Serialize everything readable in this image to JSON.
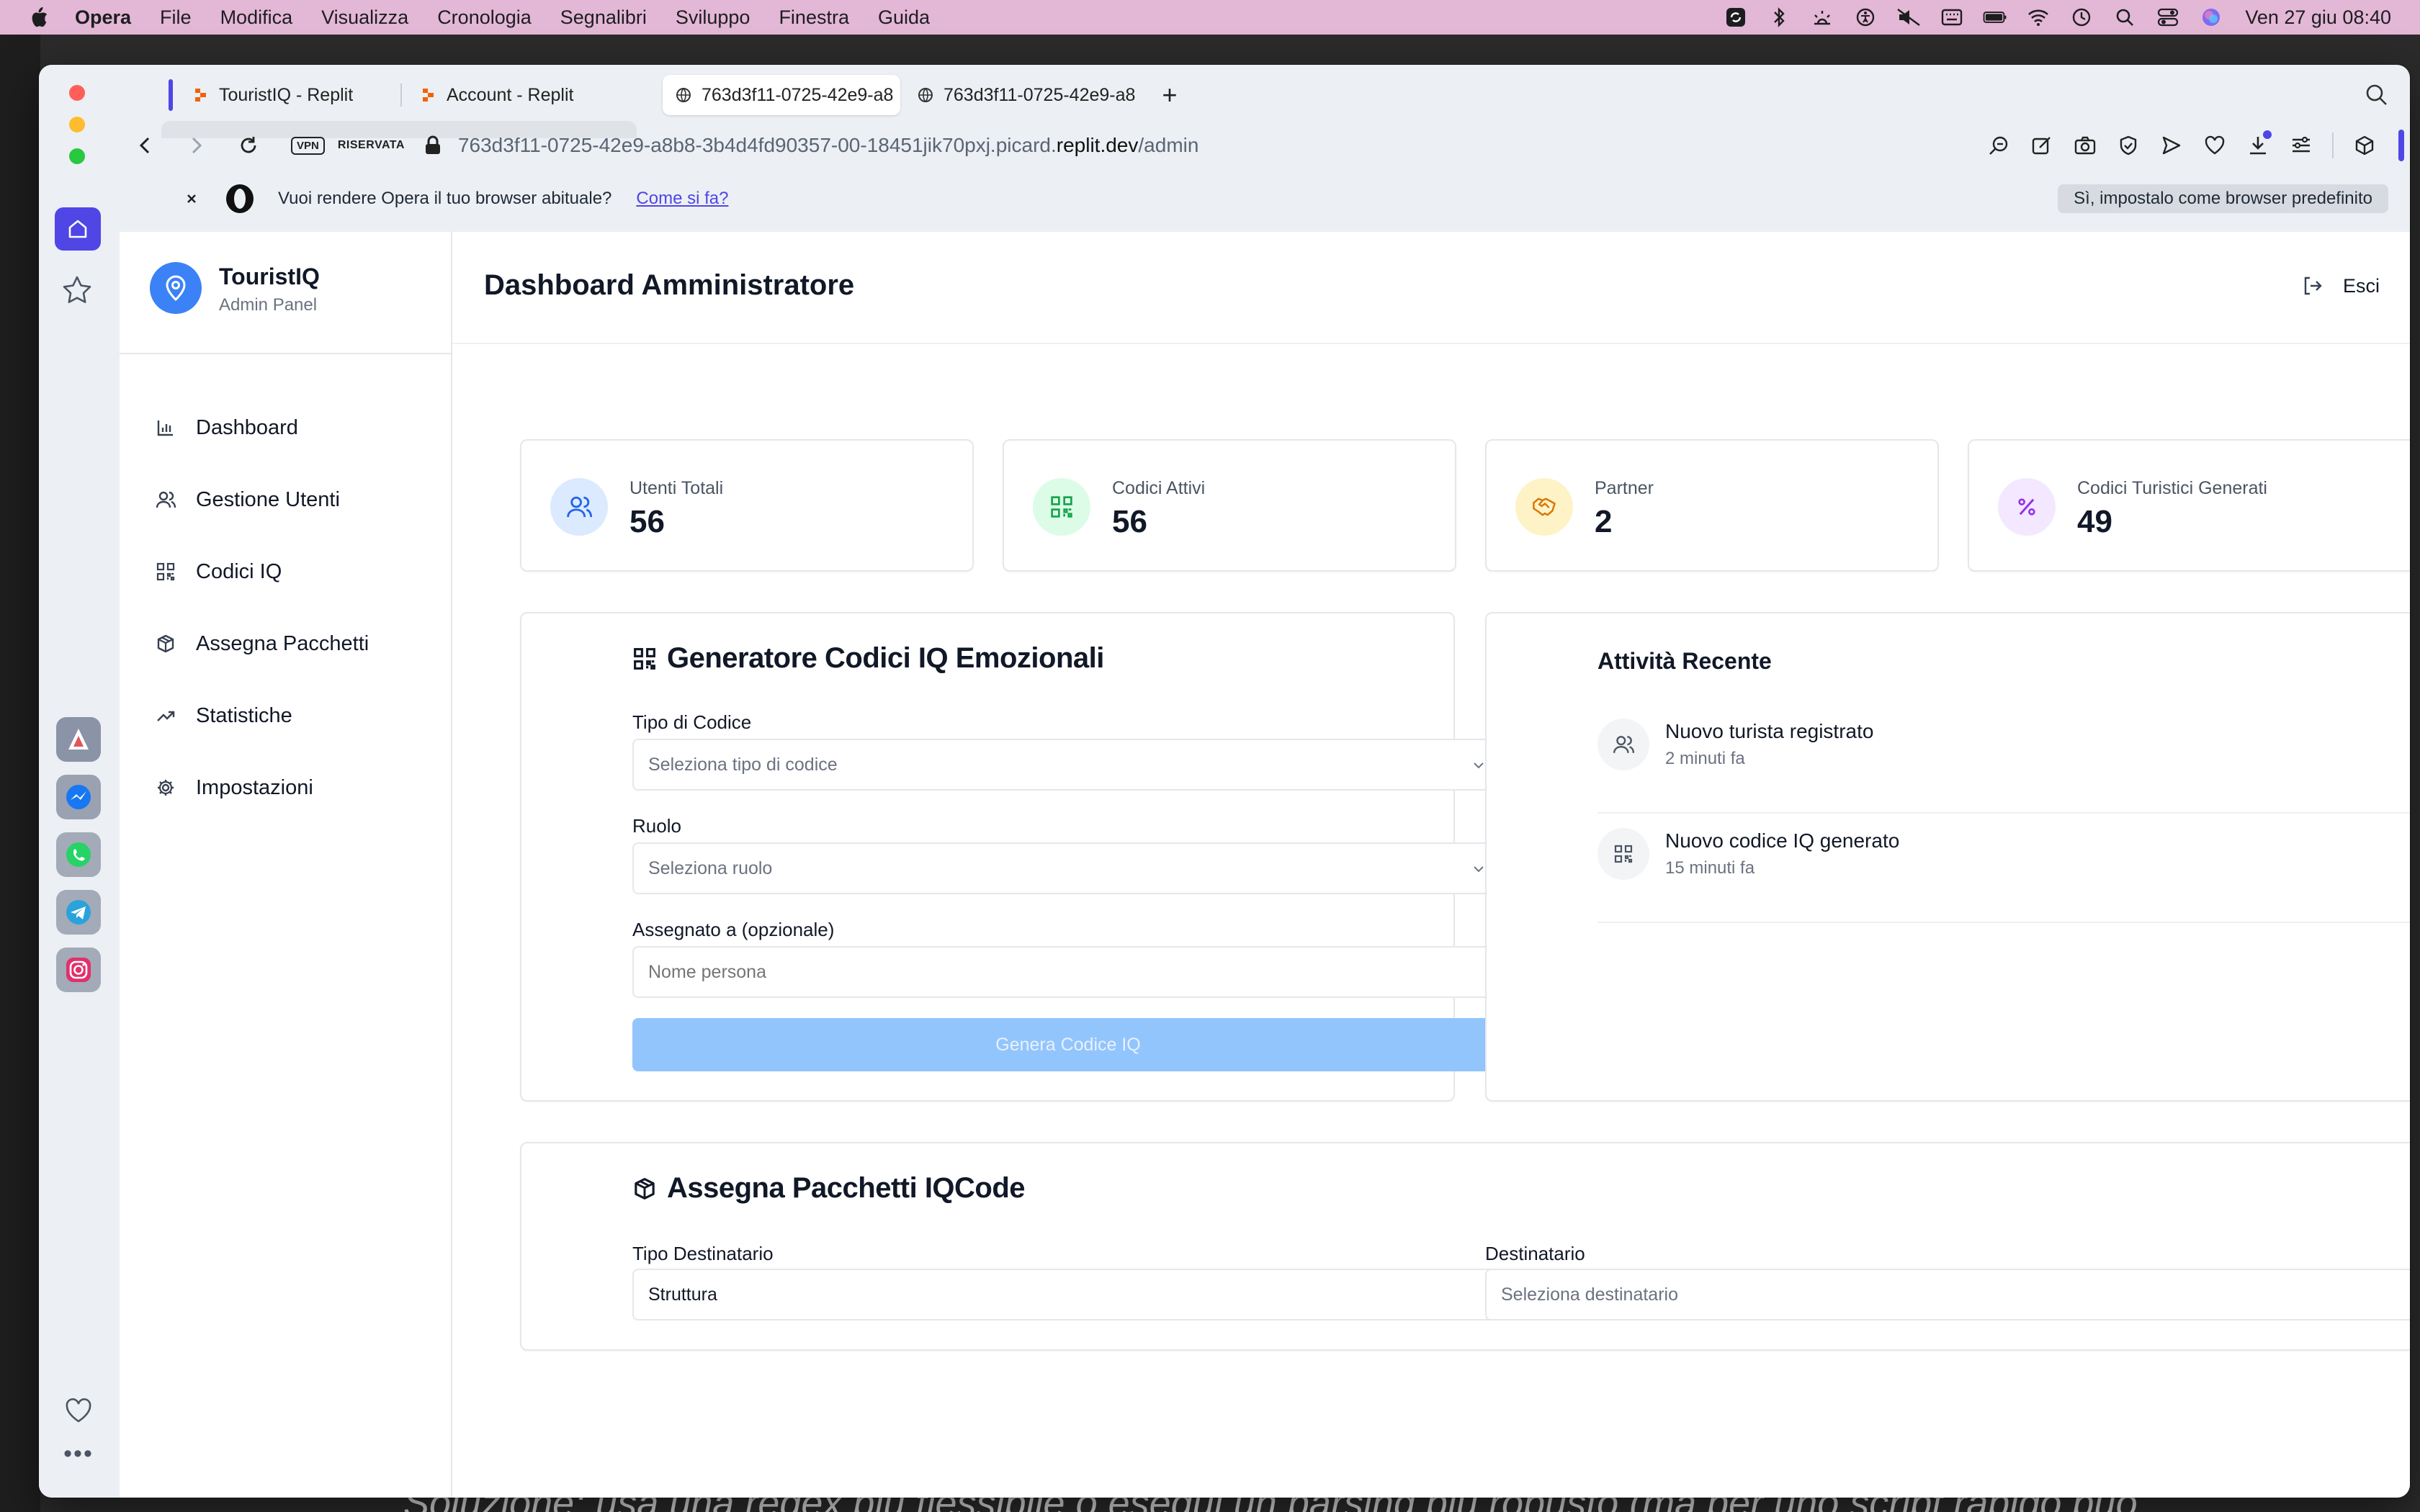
{
  "menubar": {
    "app": "Opera",
    "items": [
      "File",
      "Modifica",
      "Visualizza",
      "Cronologia",
      "Segnalibri",
      "Sviluppo",
      "Finestra",
      "Guida"
    ],
    "datetime": "Ven 27 giu  08:40"
  },
  "background": {
    "bottom_text": "Soluzione: usa una regex più flessibile o esegui un parsing più robusto (ma per uno script rapido può"
  },
  "tabs": [
    {
      "title": "TouristIQ - Replit",
      "icon": "replit-icon"
    },
    {
      "title": "Account - Replit",
      "icon": "replit-icon"
    },
    {
      "title": "763d3f11-0725-42e9-a8",
      "icon": "globe-icon",
      "active": true
    },
    {
      "title": "763d3f11-0725-42e9-a8",
      "icon": "globe-icon"
    }
  ],
  "addressbar": {
    "vpn": "VPN",
    "private": "RISERVATA",
    "url_prefix": "763d3f11-0725-42e9-a8b8-3b4d4fd90357-00-18451jik70pxj.picard.",
    "url_host": "replit.dev",
    "url_path": "/admin"
  },
  "notice": {
    "text": "Vuoi rendere Opera il tuo browser abituale?",
    "link": "Come si fa?",
    "button": "Sì, impostalo come browser predefinito"
  },
  "app": {
    "brand_name": "TouristIQ",
    "brand_sub": "Admin Panel",
    "nav": [
      {
        "label": "Dashboard",
        "icon": "bar-chart-icon"
      },
      {
        "label": "Gestione Utenti",
        "icon": "users-icon"
      },
      {
        "label": "Codici IQ",
        "icon": "qr-code-icon"
      },
      {
        "label": "Assegna Pacchetti",
        "icon": "package-icon"
      },
      {
        "label": "Statistiche",
        "icon": "trending-up-icon"
      },
      {
        "label": "Impostazioni",
        "icon": "settings-icon"
      }
    ],
    "page_title": "Dashboard Amministratore",
    "logout": "Esci"
  },
  "stats": [
    {
      "label": "Utenti Totali",
      "value": "56",
      "icon": "users-icon",
      "bg": "#dbeafe",
      "fg": "#2563eb"
    },
    {
      "label": "Codici Attivi",
      "value": "56",
      "icon": "qr-code-icon",
      "bg": "#dcfce7",
      "fg": "#16a34a"
    },
    {
      "label": "Partner",
      "value": "2",
      "icon": "handshake-icon",
      "bg": "#fef3c7",
      "fg": "#d97706"
    },
    {
      "label": "Codici Turistici Generati",
      "value": "49",
      "icon": "percent-icon",
      "bg": "#f3e8ff",
      "fg": "#9333ea"
    }
  ],
  "generator": {
    "title": "Generatore Codici IQ Emozionali",
    "type_label": "Tipo di Codice",
    "type_placeholder": "Seleziona tipo di codice",
    "role_label": "Ruolo",
    "role_placeholder": "Seleziona ruolo",
    "assigned_label": "Assegnato a (opzionale)",
    "assigned_placeholder": "Nome persona",
    "button": "Genera Codice IQ"
  },
  "activity": {
    "title": "Attività Recente",
    "items": [
      {
        "title": "Nuovo turista registrato",
        "time": "2 minuti fa",
        "icon": "users-icon"
      },
      {
        "title": "Nuovo codice IQ generato",
        "time": "15 minuti fa",
        "icon": "qr-code-icon"
      }
    ]
  },
  "packages": {
    "title": "Assegna Pacchetti IQCode",
    "recipient_type_label": "Tipo Destinatario",
    "recipient_type_value": "Struttura",
    "recipient_label": "Destinatario",
    "recipient_placeholder": "Seleziona destinatario"
  },
  "colors": {
    "accent": "#4f46e5",
    "primary": "#3b82f6",
    "button_disabled": "#93c5fd",
    "menubar": "#e3b7d6"
  }
}
